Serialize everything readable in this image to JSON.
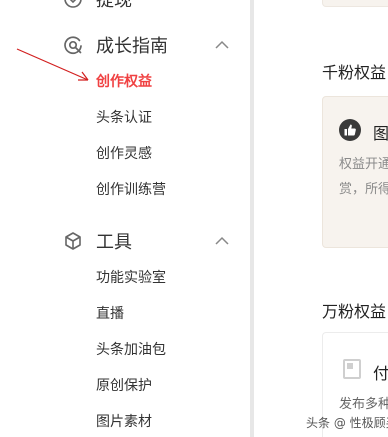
{
  "sidebar": {
    "prev_section_label": "提现",
    "growth": {
      "label": "成长指南",
      "items": [
        {
          "label": "创作权益",
          "active": true
        },
        {
          "label": "头条认证",
          "active": false
        },
        {
          "label": "创作灵感",
          "active": false
        },
        {
          "label": "创作训练营",
          "active": false
        }
      ]
    },
    "tools": {
      "label": "工具",
      "items": [
        {
          "label": "功能实验室"
        },
        {
          "label": "直播"
        },
        {
          "label": "头条加油包"
        },
        {
          "label": "原创保护"
        },
        {
          "label": "图片素材"
        }
      ]
    }
  },
  "main": {
    "section1_title": "千粉权益",
    "card1": {
      "title": "图",
      "line1": "权益开通",
      "line2": "赏，所得"
    },
    "section2_title": "万粉权益",
    "card2": {
      "title": "付",
      "line1": "发布多种"
    }
  },
  "watermark": "头条 @ 性极顾买",
  "colors": {
    "active": "#f04142",
    "annotation_arrow": "#d21f1f",
    "card_bg": "#f7f3ee"
  },
  "icons": {
    "growth": "growth-guide-icon",
    "tools": "tools-cube-icon",
    "collapse": "chevron-up-icon",
    "card1": "thumbs-up-icon",
    "card2": "document-icon"
  }
}
